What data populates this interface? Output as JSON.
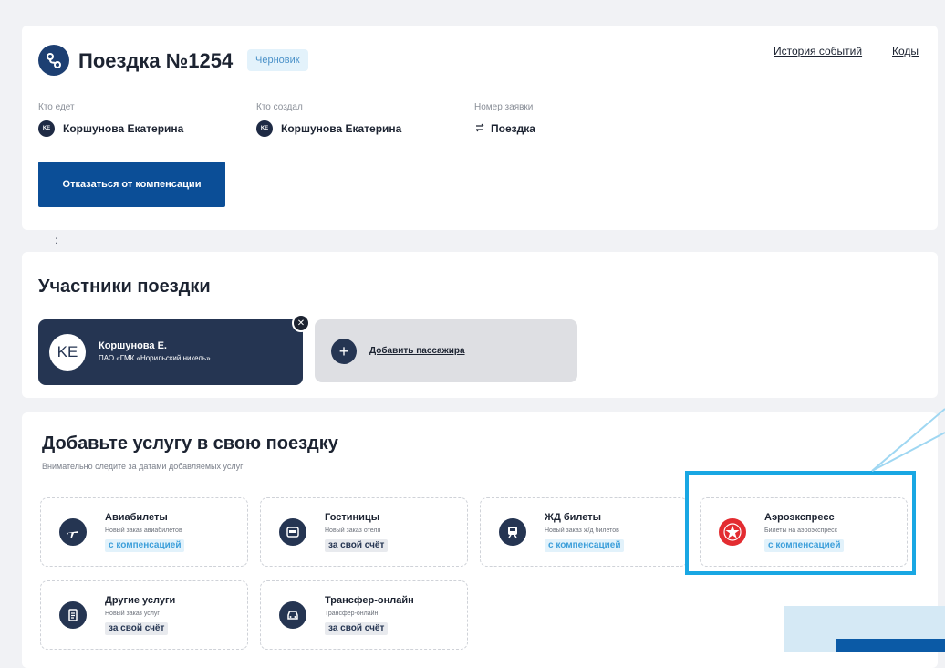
{
  "trip": {
    "title": "Поездка №1254",
    "status": "Черновик",
    "links": {
      "history": "История событий",
      "codes": "Коды"
    },
    "who_goes": {
      "label": "Кто едет",
      "initials": "KE",
      "name": "Коршунова Екатерина"
    },
    "who_created": {
      "label": "Кто создал",
      "initials": "KE",
      "name": "Коршунова Екатерина"
    },
    "request": {
      "label": "Номер заявки",
      "value": "Поездка"
    },
    "refuse_button": "Отказаться от компенсации",
    "colon": ":"
  },
  "participants": {
    "heading": "Участники поездки",
    "passenger": {
      "initials": "KE",
      "name": "Коршунова Е.",
      "org": "ПАО «ГМК «Норильский никель»"
    },
    "add_label": "Добавить пассажира",
    "add_symbol": "+",
    "remove_symbol": "✕"
  },
  "services": {
    "heading": "Добавьте услугу в свою поездку",
    "subheading": "Внимательно следите за датами добавляемых услуг",
    "items": [
      {
        "icon": "plane-icon",
        "title": "Авиабилеты",
        "subtitle": "Новый заказ авиабилетов",
        "tag": "с компенсацией",
        "tag_type": "compensation"
      },
      {
        "icon": "hotel-bed-icon",
        "title": "Гостиницы",
        "subtitle": "Новый заказ отеля",
        "tag": "за свой счёт",
        "tag_type": "own"
      },
      {
        "icon": "train-icon",
        "title": "ЖД билеты",
        "subtitle": "Новый заказ ж/д билетов",
        "tag": "с компенсацией",
        "tag_type": "compensation"
      },
      {
        "icon": "aeroexpress-star-icon",
        "title": "Аэроэкспресс",
        "subtitle": "Билеты на аэроэкспресс",
        "tag": "с компенсацией",
        "tag_type": "compensation"
      },
      {
        "icon": "document-icon",
        "title": "Другие услуги",
        "subtitle": "Новый заказ услуг",
        "tag": "за свой счёт",
        "tag_type": "own"
      },
      {
        "icon": "car-icon",
        "title": "Трансфер-онлайн",
        "subtitle": "Трансфер-онлайн",
        "tag": "за свой счёт",
        "tag_type": "own"
      }
    ]
  },
  "colors": {
    "primary_button": "#0b4e97",
    "dark_navy": "#253552",
    "compensation_tag_bg": "#e2f2fb",
    "compensation_tag_text": "#3d9fda",
    "highlight": "#19a7e3",
    "aeroexpress_red": "#e32c31"
  }
}
